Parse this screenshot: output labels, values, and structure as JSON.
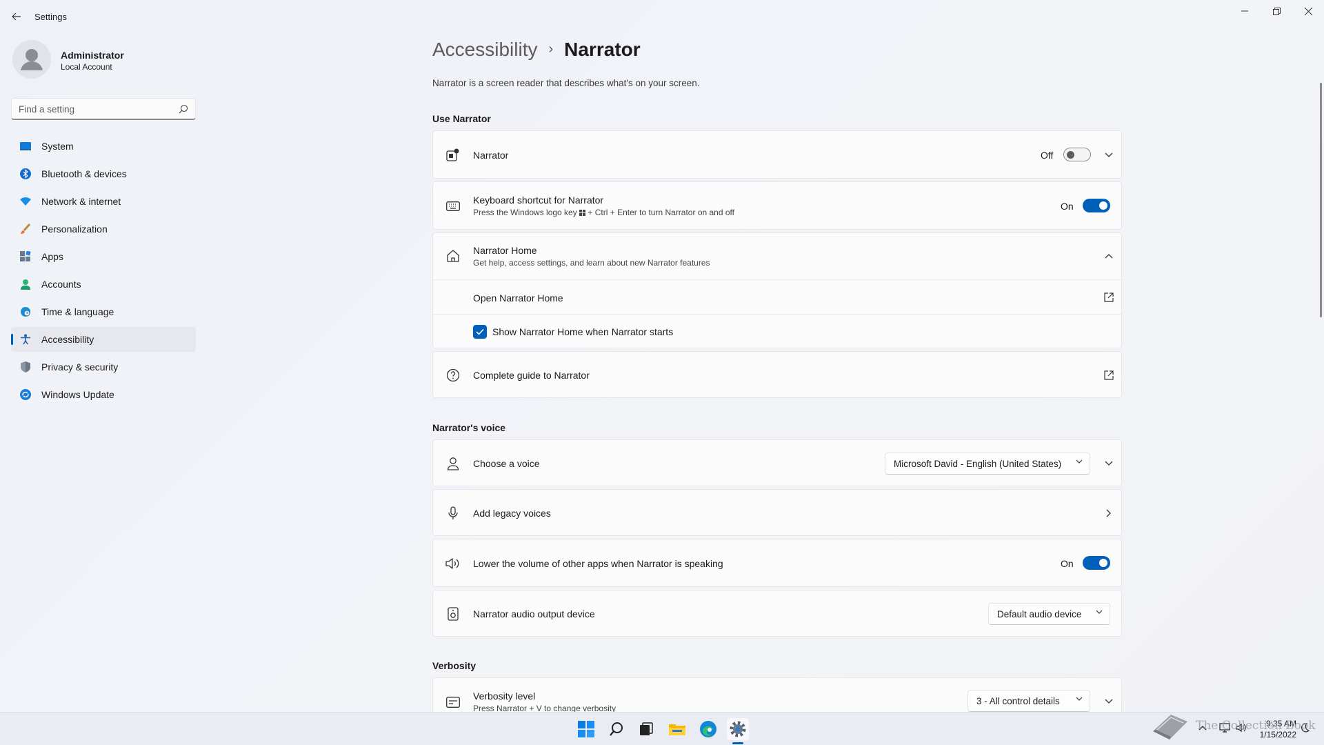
{
  "titlebar": {
    "app_title": "Settings",
    "back_icon": "arrow-left-icon",
    "controls": [
      "minimize-icon",
      "restore-icon",
      "close-icon"
    ]
  },
  "profile": {
    "name": "Administrator",
    "account_type": "Local Account"
  },
  "search": {
    "placeholder": "Find a setting"
  },
  "sidebar": {
    "items": [
      {
        "label": "System",
        "icon": "monitor-icon"
      },
      {
        "label": "Bluetooth & devices",
        "icon": "bluetooth-icon"
      },
      {
        "label": "Network & internet",
        "icon": "wifi-icon"
      },
      {
        "label": "Personalization",
        "icon": "brush-icon"
      },
      {
        "label": "Apps",
        "icon": "apps-icon"
      },
      {
        "label": "Accounts",
        "icon": "person-icon"
      },
      {
        "label": "Time & language",
        "icon": "globe-clock-icon"
      },
      {
        "label": "Accessibility",
        "icon": "accessibility-icon",
        "active": true
      },
      {
        "label": "Privacy & security",
        "icon": "shield-icon"
      },
      {
        "label": "Windows Update",
        "icon": "update-icon"
      }
    ],
    "active_index": 7
  },
  "main": {
    "breadcrumb_parent": "Accessibility",
    "breadcrumb_separator": "›",
    "breadcrumb_current": "Narrator",
    "description": "Narrator is a screen reader that describes what's on your screen.",
    "sections": {
      "use_narrator": "Use Narrator",
      "narrators_voice": "Narrator's voice",
      "verbosity": "Verbosity"
    },
    "narrator": {
      "title": "Narrator",
      "state": "Off",
      "on": false
    },
    "keyboard_shortcut": {
      "title": "Keyboard shortcut for Narrator",
      "subtitle_before": "Press the Windows logo key",
      "subtitle_after": "+ Ctrl + Enter to turn Narrator on and off",
      "state": "On",
      "on": true
    },
    "narrator_home": {
      "title": "Narrator Home",
      "subtitle": "Get help, access settings, and learn about new Narrator features",
      "open_label": "Open Narrator Home",
      "checkbox_label": "Show Narrator Home when Narrator starts",
      "checkbox_checked": true
    },
    "complete_guide": {
      "title": "Complete guide to Narrator"
    },
    "choose_voice": {
      "title": "Choose a voice",
      "value": "Microsoft David - English (United States)"
    },
    "legacy_voices": {
      "title": "Add legacy voices"
    },
    "lower_volume": {
      "title": "Lower the volume of other apps when Narrator is speaking",
      "state": "On",
      "on": true
    },
    "audio_output": {
      "title": "Narrator audio output device",
      "value": "Default audio device"
    },
    "verbosity_level": {
      "title": "Verbosity level",
      "subtitle": "Press Narrator + V to change verbosity",
      "value": "3 - All control details"
    }
  },
  "taskbar": {
    "apps": [
      "windows-start-icon",
      "search-icon",
      "task-view-icon",
      "file-explorer-icon",
      "edge-icon",
      "settings-icon"
    ],
    "active_app": "settings-icon",
    "time": "9:35 AM",
    "date": "1/15/2022"
  },
  "watermark": "The Collection Book",
  "colors": {
    "accent": "#005fb8",
    "background": "#f2f4f9",
    "card": "#fbfbfc"
  }
}
